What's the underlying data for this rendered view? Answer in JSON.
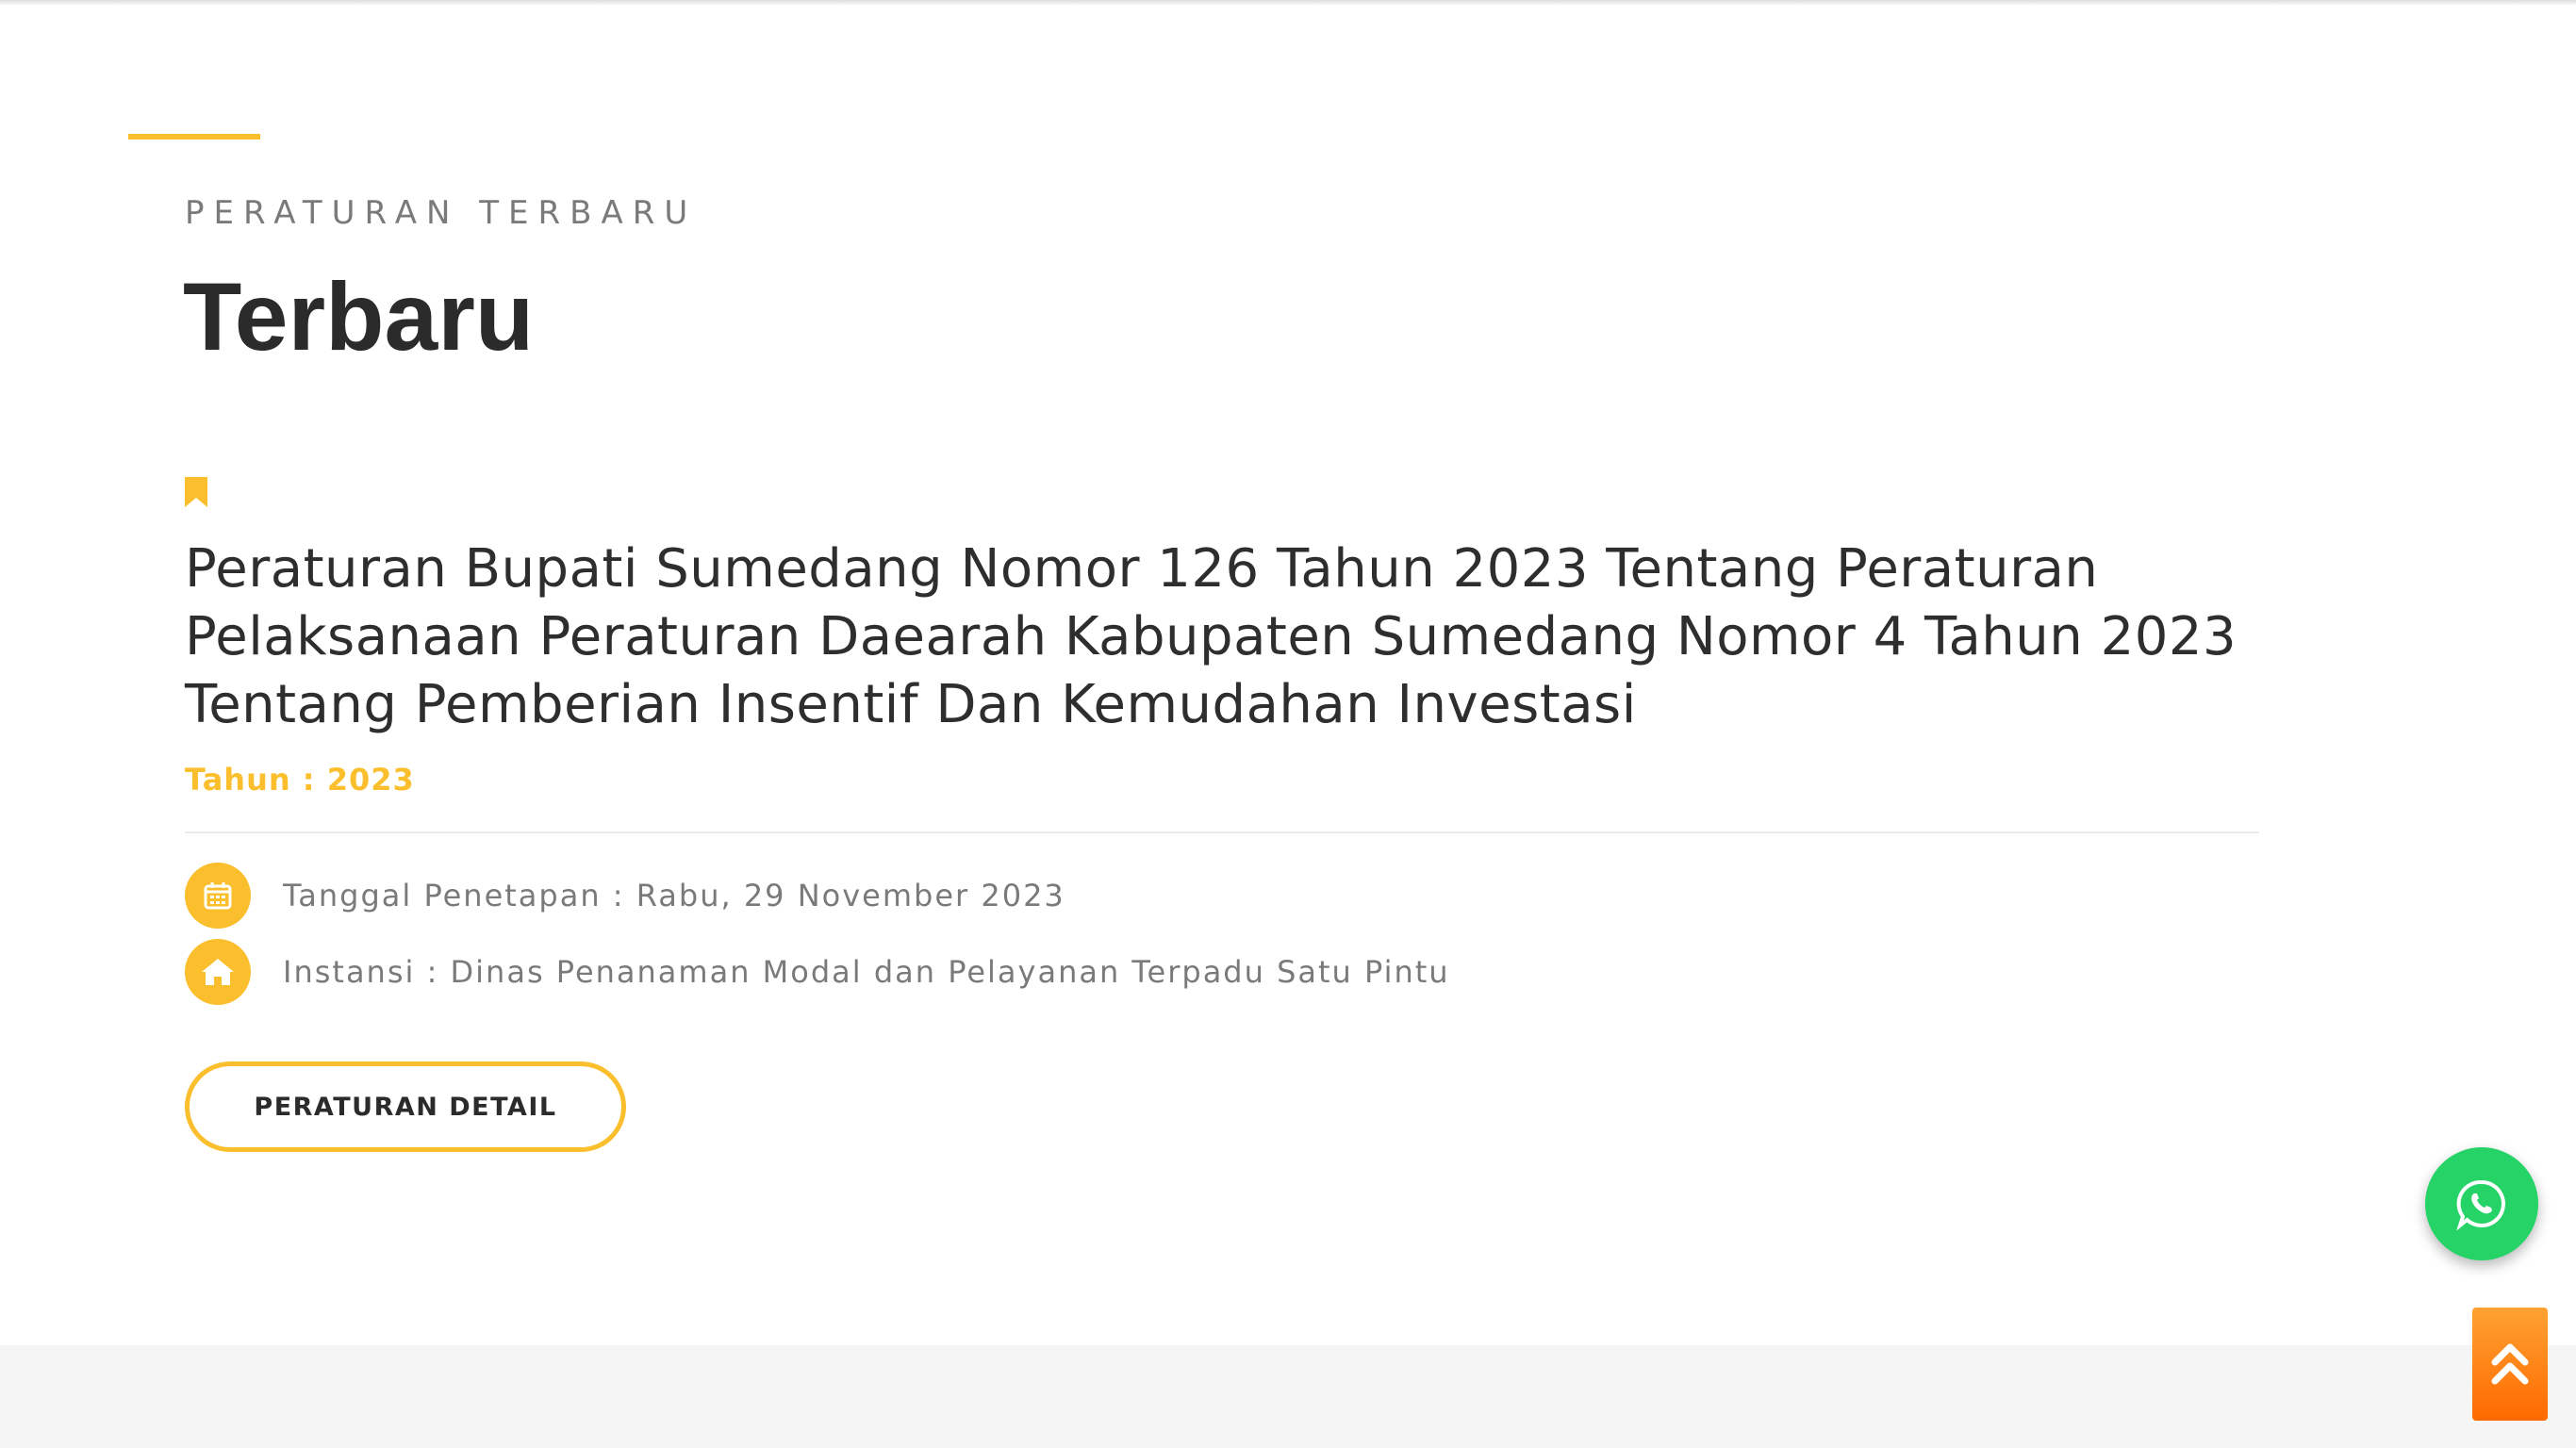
{
  "section": {
    "eyebrow": "PERATURAN TERBARU",
    "title": "Terbaru"
  },
  "regulation": {
    "title": "Peraturan Bupati Sumedang Nomor 126 Tahun 2023 Tentang Peraturan Pelaksanaan Peraturan Daearah Kabupaten Sumedang Nomor 4 Tahun 2023 Tentang Pemberian Insentif Dan Kemudahan Investasi",
    "year_text": "Tahun : 2023",
    "date_text": "Tanggal Penetapan : Rabu, 29 November 2023",
    "agency_text": "Instansi : Dinas Penanaman Modal dan Pelayanan Terpadu Satu Pintu",
    "detail_button_label": "PERATURAN DETAIL"
  },
  "icons": {
    "bookmark": "bookmark-icon",
    "date": "calendar-icon",
    "agency": "home-icon",
    "chat": "whatsapp-icon",
    "scroll_top": "double-chevron-up-icon"
  },
  "colors": {
    "accent": "#fbbf2e",
    "whatsapp": "#25d366",
    "scroll_top_gradient_start": "#ffa233",
    "scroll_top_gradient_end": "#ff6a00",
    "title_text": "#2b2b2b",
    "meta_text": "#7a7a7a"
  }
}
